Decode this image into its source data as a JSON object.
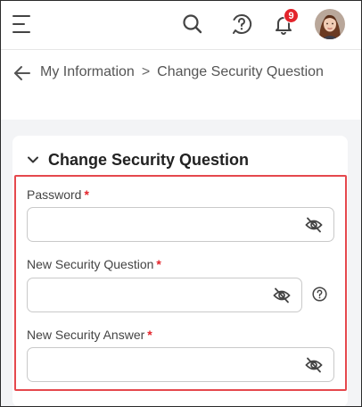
{
  "topbar": {
    "notification_count": "9",
    "icons": [
      "menu-icon",
      "search-icon",
      "help-icon",
      "bell-icon",
      "avatar"
    ]
  },
  "breadcrumb": {
    "parent": "My Information",
    "separator": ">",
    "current": "Change Security Question"
  },
  "section": {
    "title": "Change Security Question",
    "fields": [
      {
        "label": "Password",
        "required_mark": "*",
        "value": ""
      },
      {
        "label": "New Security Question",
        "required_mark": "*",
        "value": ""
      },
      {
        "label": "New Security Answer",
        "required_mark": "*",
        "value": ""
      }
    ]
  },
  "colors": {
    "accent_required": "#e3242b",
    "highlight_border": "#e5484d",
    "badge": "#e3242b",
    "content_background": "#f3f4f6"
  }
}
